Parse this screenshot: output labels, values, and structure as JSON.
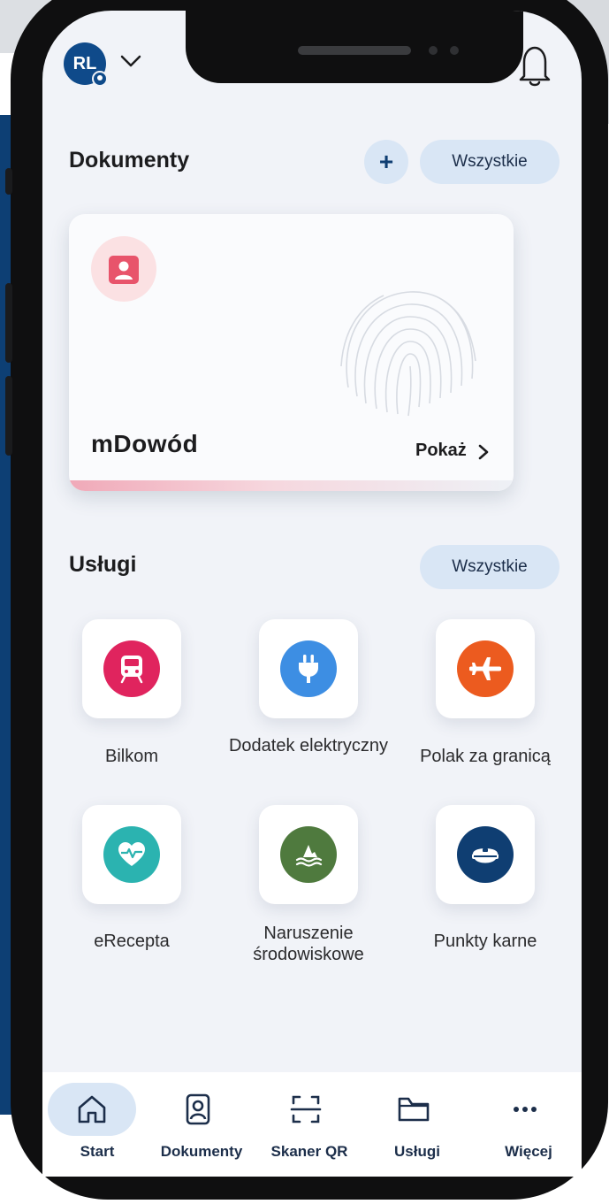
{
  "header": {
    "avatar_initials": "RL",
    "notifications_icon": "bell-icon"
  },
  "documents": {
    "title": "Dokumenty",
    "add_label": "+",
    "all_label": "Wszystkie",
    "card": {
      "name": "mDowód",
      "show_label": "Pokaż",
      "icon": "id-card-icon"
    }
  },
  "services": {
    "title": "Usługi",
    "all_label": "Wszystkie",
    "items": [
      {
        "label": "Bilkom",
        "icon": "train-icon",
        "color": "#e0245e"
      },
      {
        "label": "Dodatek elektryczny",
        "icon": "plug-icon",
        "color": "#3d8ee3"
      },
      {
        "label": "Polak za granicą",
        "icon": "airplane-icon",
        "color": "#ec5b1f"
      },
      {
        "label": "eRecepta",
        "icon": "heart-pulse-icon",
        "color": "#2bb3b0"
      },
      {
        "label": "Naruszenie środowiskowe",
        "icon": "environment-icon",
        "color": "#4f7a3e"
      },
      {
        "label": "Punkty karne",
        "icon": "police-cap-icon",
        "color": "#0f3e72"
      }
    ]
  },
  "nav": {
    "items": [
      {
        "label": "Start",
        "icon": "home-icon",
        "active": true
      },
      {
        "label": "Dokumenty",
        "icon": "id-badge-icon",
        "active": false
      },
      {
        "label": "Skaner QR",
        "icon": "qr-scan-icon",
        "active": false
      },
      {
        "label": "Usługi",
        "icon": "folder-icon",
        "active": false
      },
      {
        "label": "Więcej",
        "icon": "more-icon",
        "active": false
      }
    ]
  },
  "colors": {
    "accent": "#0f4a8a",
    "pill_bg": "#d9e6f5",
    "screen_bg": "#f1f3f8"
  }
}
